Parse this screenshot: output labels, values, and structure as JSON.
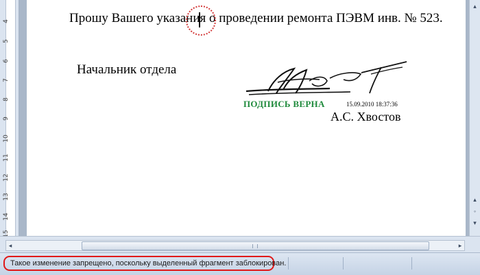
{
  "document": {
    "body_text": "Прошу Вашего указания о проведении ремонта ПЭВМ инв. № 523.",
    "department_line": "Начальник отдела",
    "signature": {
      "status_label": "ПОДПИСЬ ВЕРНА",
      "timestamp": "15.09.2010 18:37:36",
      "signer": "А.С. Хвостов",
      "status_color": "#1f8a3c"
    }
  },
  "ruler": {
    "numbers": [
      "4",
      "5",
      "6",
      "7",
      "8",
      "9",
      "10",
      "11",
      "12",
      "13",
      "14",
      "15"
    ]
  },
  "scrollbars": {
    "vertical_buttons": [
      "scroll-up-arrow-icon",
      "prev-page-icon",
      "select-browse-object-icon",
      "next-page-icon"
    ],
    "horizontal_left": "◂",
    "horizontal_right": "▸"
  },
  "status_bar": {
    "message": "Такое изменение запрещено, поскольку выделенный фрагмент заблокирован.",
    "highlight_color": "#e01818"
  }
}
